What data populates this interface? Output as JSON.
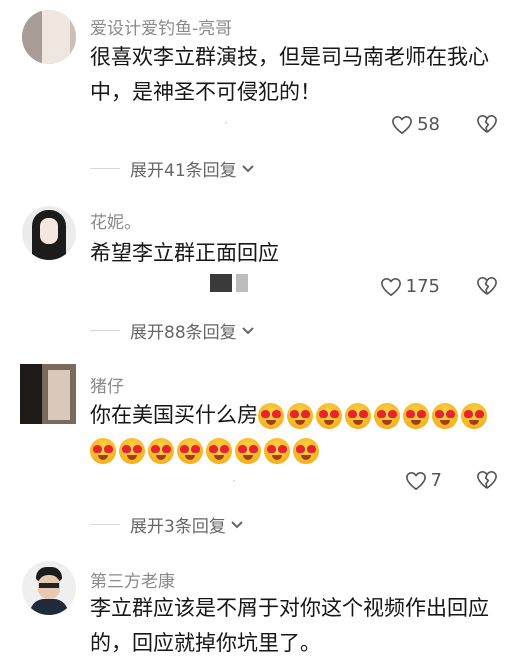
{
  "comments": [
    {
      "username": "爱设计爱钓鱼-亮哥",
      "text": "很喜欢李立群演技，但是司马南老师在我心中，是神圣不可侵犯的！",
      "likes": "58",
      "replies": "展开41条回复"
    },
    {
      "username": "花妮。",
      "text": "希望李立群正面回应",
      "likes": "175",
      "replies": "展开88条回复"
    },
    {
      "username": "猪仔",
      "text": "你在美国买什么房",
      "emoji_count": 16,
      "emoji_name": "heart-eyes-emoji",
      "likes": "7",
      "replies": "展开3条回复"
    },
    {
      "username": "第三方老康",
      "text": "李立群应该是不屑于对你这个视频作出回应的，回应就掉你坑里了。"
    }
  ],
  "icons": {
    "like": "heart-outline-icon",
    "dislike": "broken-heart-icon",
    "expand": "chevron-down-icon"
  },
  "colors": {
    "text": "#161616",
    "username": "#8a8a8a",
    "meta": "#555555",
    "emoji_face": "#f7b21f",
    "emoji_hearts": "#e8222f"
  }
}
